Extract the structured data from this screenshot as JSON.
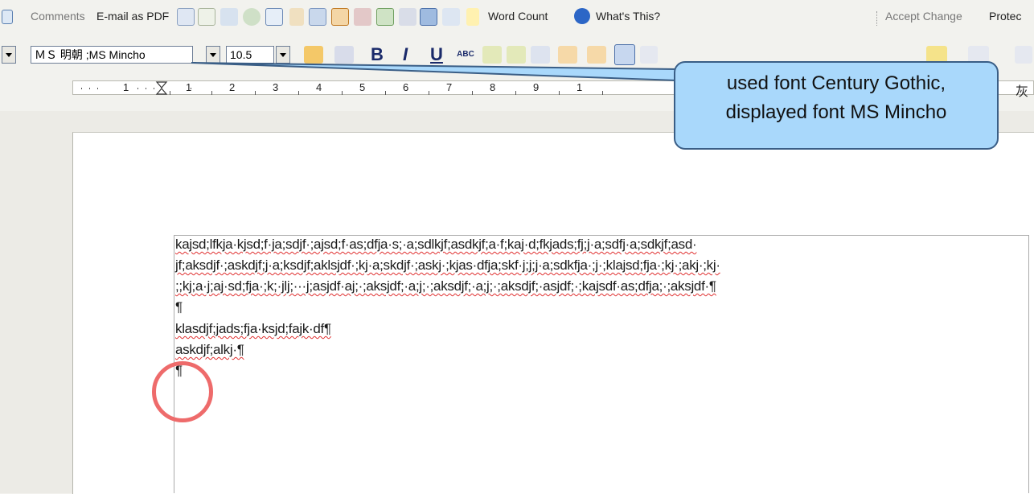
{
  "toolbar1": {
    "comments": "Comments",
    "email_pdf": "E-mail as PDF",
    "word_count": "Word Count",
    "whats_this": "What's This?",
    "accept_change": "Accept Change",
    "protect": "Protec"
  },
  "toolbar2": {
    "font_name": "ＭＳ 明朝 ;MS Mincho",
    "font_size": "10.5",
    "bold": "B",
    "italic": "I",
    "underline": "U",
    "strike": "ABC"
  },
  "ruler": {
    "labels": [
      "1",
      "1",
      "2",
      "3",
      "4",
      "5",
      "6",
      "7",
      "8",
      "9",
      "1",
      "灰"
    ]
  },
  "callout": {
    "line1": "used font Century Gothic,",
    "line2": "displayed font MS Mincho"
  },
  "document": {
    "lines": [
      "kajsd;lfkja·kjsd;f·ja;sdjf·;ajsd;f·as;dfja·s;·a;sdlkjf;asdkjf;a·f;kaj·d;fkjads;fj;j·a;sdfj·a;sdkjf;asd·",
      "jf;aksdjf·;askdjf;j·a;ksdjf;aklsjdf·;kj·a;skdjf·;askj·;kjas·dfja;skf·j;j;j·a;sdkfja·;j·;klajsd;fja·;kj·;akj·;kj·",
      ";;kj;a·j;aj·sd;fja·;k;·jlj;···j;asjdf·aj;·;aksjdf;·a;j;·;aksdjf;·a;j;·;aksdjf;·asjdf;·;kajsdf·as;dfja;·;aksjdf·¶",
      "¶",
      "klasdjf;jads;fja·ksjd;fajk·df¶",
      "askdjf;alkj·¶",
      "¶"
    ]
  },
  "colors": {
    "callout_fill": "#a9d8fb",
    "callout_border": "#3a5e86",
    "circle": "#ee6b6b"
  }
}
